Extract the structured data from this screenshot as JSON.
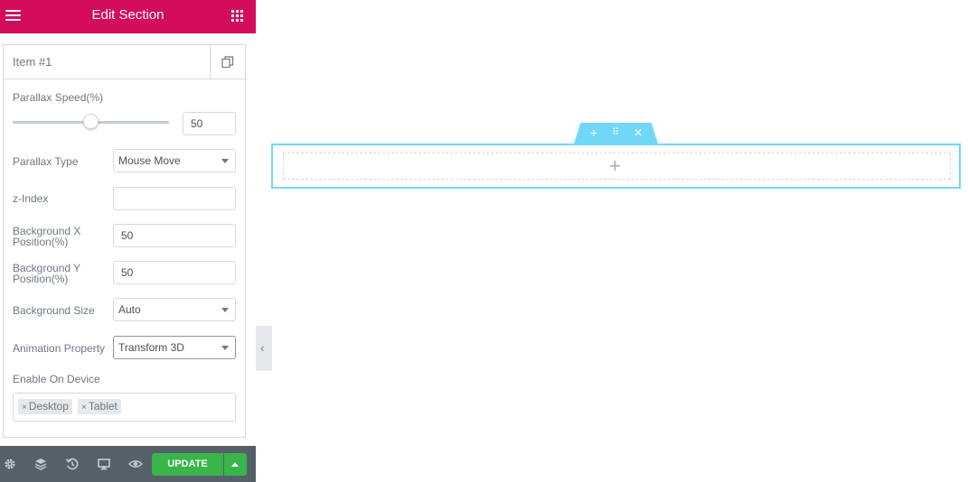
{
  "header": {
    "title": "Edit Section"
  },
  "repeater": {
    "item_title": "Item #1"
  },
  "fields": {
    "parallax_speed": {
      "label": "Parallax Speed(%)",
      "value": "50",
      "slider_percent": 50
    },
    "parallax_type": {
      "label": "Parallax Type",
      "value": "Mouse Move"
    },
    "z_index": {
      "label": "z-Index",
      "value": ""
    },
    "bg_x": {
      "label_line1": "Background X",
      "label_line2": "Position(%)",
      "value": "50"
    },
    "bg_y": {
      "label_line1": "Background Y",
      "label_line2": "Position(%)",
      "value": "50"
    },
    "bg_size": {
      "label": "Background Size",
      "value": "Auto"
    },
    "animation_property": {
      "label": "Animation Property",
      "value": "Transform 3D"
    },
    "enable_on_device": {
      "label": "Enable On Device",
      "tags": [
        "Desktop",
        "Tablet"
      ],
      "remove_glyph": "×"
    }
  },
  "footer": {
    "update_label": "UPDATE",
    "icons": [
      "settings-icon",
      "layers-icon",
      "history-icon",
      "responsive-icon",
      "preview-icon"
    ]
  },
  "canvas": {
    "section_handle_icons": [
      "add-icon",
      "drag-icon",
      "close-icon"
    ],
    "add_glyph": "+",
    "move_glyph": "⠿",
    "close_glyph": "✕"
  },
  "collapse_glyph": "‹",
  "colors": {
    "header": "#d30c5c",
    "footer": "#556068",
    "update": "#39b54a",
    "section_accent": "#71d7f7"
  }
}
